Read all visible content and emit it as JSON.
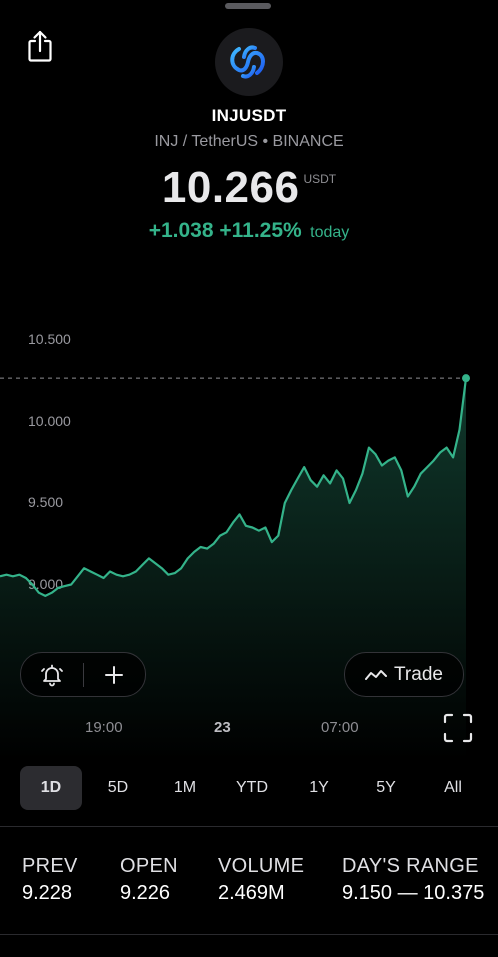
{
  "header": {
    "symbol": "INJUSDT",
    "subtitle": "INJ / TetherUS • BINANCE",
    "logo_icon": "injective-logo-icon",
    "share_icon": "share-icon"
  },
  "quote": {
    "price": "10.266",
    "currency": "USDT",
    "change": "+1.038 +11.25%",
    "change_period": "today",
    "change_color": "#34b38a"
  },
  "chart": {
    "y_labels": [
      "10.500",
      "10.000",
      "9.500",
      "9.000"
    ],
    "x_labels": [
      "19:00",
      "23",
      "07:00"
    ],
    "line_color": "#34b38a"
  },
  "actions": {
    "alert_icon": "bell-plus-icon",
    "add_icon": "plus-icon",
    "trade_label": "Trade",
    "trade_icon": "trend-icon",
    "expand_icon": "fullscreen-icon"
  },
  "ranges": {
    "items": [
      "1D",
      "5D",
      "1M",
      "YTD",
      "1Y",
      "5Y",
      "All"
    ],
    "selected": "1D"
  },
  "stats": {
    "prev_label": "PREV",
    "prev_value": "9.228",
    "open_label": "OPEN",
    "open_value": "9.226",
    "volume_label": "VOLUME",
    "volume_value": "2.469M",
    "range_label": "DAY'S RANGE",
    "range_value": "9.150 — 10.375"
  },
  "chart_data": {
    "type": "area",
    "x_tick_labels": [
      "19:00",
      "23",
      "07:00"
    ],
    "y_tick_labels": [
      "10.500",
      "10.000",
      "9.500",
      "9.000"
    ],
    "ylim": [
      8.8,
      10.6
    ],
    "previous_close_reference": 10.266,
    "values": [
      9.05,
      9.06,
      9.05,
      9.06,
      9.04,
      9.0,
      8.95,
      8.93,
      8.95,
      8.98,
      8.99,
      9.0,
      9.05,
      9.1,
      9.08,
      9.06,
      9.04,
      9.08,
      9.06,
      9.05,
      9.06,
      9.08,
      9.12,
      9.16,
      9.13,
      9.1,
      9.06,
      9.07,
      9.1,
      9.16,
      9.2,
      9.23,
      9.22,
      9.25,
      9.3,
      9.32,
      9.38,
      9.43,
      9.36,
      9.35,
      9.33,
      9.35,
      9.26,
      9.3,
      9.5,
      9.58,
      9.65,
      9.72,
      9.64,
      9.6,
      9.67,
      9.62,
      9.7,
      9.65,
      9.5,
      9.58,
      9.68,
      9.84,
      9.8,
      9.73,
      9.76,
      9.78,
      9.7,
      9.54,
      9.6,
      9.68,
      9.72,
      9.76,
      9.81,
      9.84,
      9.78,
      9.95,
      10.266
    ],
    "grid": false,
    "legend": "none"
  }
}
